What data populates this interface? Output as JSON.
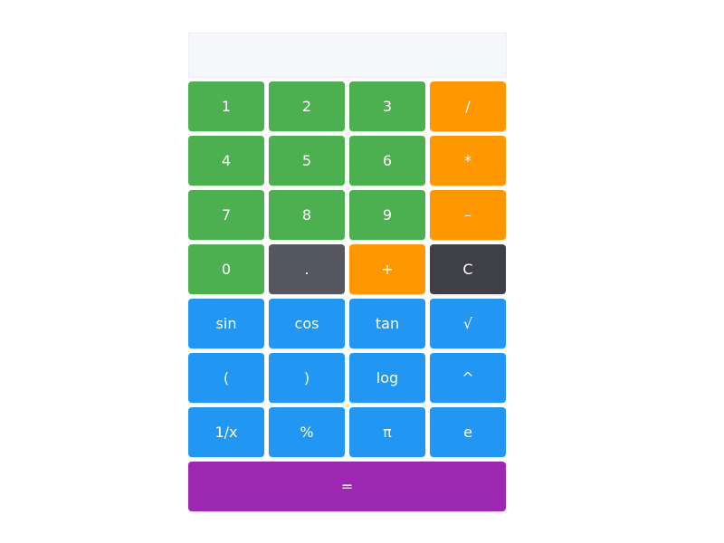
{
  "display": {
    "value": ""
  },
  "colors": {
    "number": "#4caf50",
    "operator": "#ff9800",
    "decimal": "#55565f",
    "clear": "#3f3f48",
    "function": "#2196f3",
    "equals": "#9c27b0"
  },
  "buttons": [
    {
      "label": "1",
      "type": "num",
      "name": "digit-1-button"
    },
    {
      "label": "2",
      "type": "num",
      "name": "digit-2-button"
    },
    {
      "label": "3",
      "type": "num",
      "name": "digit-3-button"
    },
    {
      "label": "/",
      "type": "op",
      "name": "divide-button"
    },
    {
      "label": "4",
      "type": "num",
      "name": "digit-4-button"
    },
    {
      "label": "5",
      "type": "num",
      "name": "digit-5-button"
    },
    {
      "label": "6",
      "type": "num",
      "name": "digit-6-button"
    },
    {
      "label": "*",
      "type": "op",
      "name": "multiply-button"
    },
    {
      "label": "7",
      "type": "num",
      "name": "digit-7-button"
    },
    {
      "label": "8",
      "type": "num",
      "name": "digit-8-button"
    },
    {
      "label": "9",
      "type": "num",
      "name": "digit-9-button"
    },
    {
      "label": "–",
      "type": "op",
      "name": "subtract-button"
    },
    {
      "label": "0",
      "type": "num",
      "name": "digit-0-button"
    },
    {
      "label": ".",
      "type": "dot",
      "name": "decimal-button"
    },
    {
      "label": "+",
      "type": "op",
      "name": "add-button"
    },
    {
      "label": "C",
      "type": "clear",
      "name": "clear-button"
    },
    {
      "label": "sin",
      "type": "fn",
      "name": "sin-button"
    },
    {
      "label": "cos",
      "type": "fn",
      "name": "cos-button"
    },
    {
      "label": "tan",
      "type": "fn",
      "name": "tan-button"
    },
    {
      "label": "√",
      "type": "fn",
      "name": "sqrt-button"
    },
    {
      "label": "(",
      "type": "fn",
      "name": "open-paren-button"
    },
    {
      "label": ")",
      "type": "fn",
      "name": "close-paren-button"
    },
    {
      "label": "log",
      "type": "fn",
      "name": "log-button"
    },
    {
      "label": "^",
      "type": "fn",
      "name": "power-button"
    },
    {
      "label": "1/x",
      "type": "fn",
      "name": "reciprocal-button"
    },
    {
      "label": "%",
      "type": "fn",
      "name": "percent-button"
    },
    {
      "label": "π",
      "type": "fn",
      "name": "pi-button"
    },
    {
      "label": "e",
      "type": "fn",
      "name": "euler-button"
    },
    {
      "label": "=",
      "type": "eq",
      "name": "equals-button"
    }
  ]
}
